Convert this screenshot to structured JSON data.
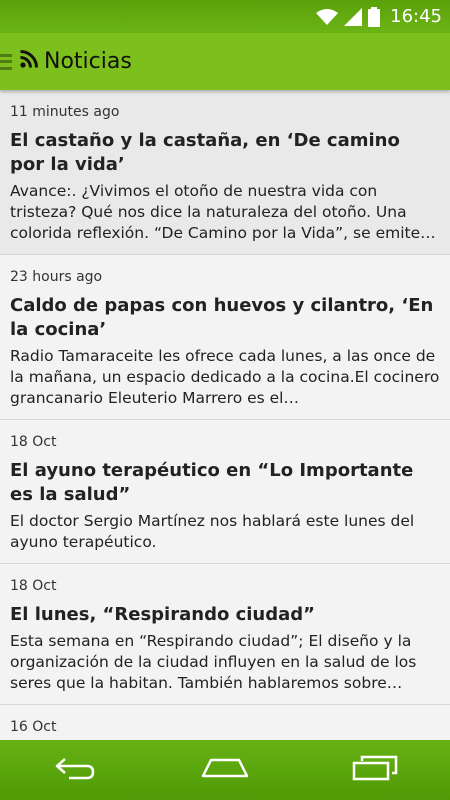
{
  "status_bar": {
    "time": "16:45",
    "icons": [
      "wifi-icon",
      "signal-icon",
      "battery-icon"
    ]
  },
  "action_bar": {
    "title": "Noticias",
    "icons": [
      "drawer-icon",
      "rss-icon"
    ]
  },
  "colors": {
    "status_bar": "#5aa00a",
    "action_bar": "#7dbf1c",
    "nav_bar": "#5aa60a",
    "list_background": "#f3f3f3"
  },
  "news": [
    {
      "date": "11 minutes ago",
      "title": "El castaño y la castaña, en ‘De camino por la vida’",
      "summary": "Avance:. ¿Vivimos el otoño de nuestra vida con tristeza? Qué nos dice la naturaleza del otoño. Una colorida reflexión. “De Camino por la Vida”, se emite…"
    },
    {
      "date": "23 hours ago",
      "title": "Caldo de papas con huevos y cilantro, ‘En la cocina’",
      "summary": "Radio Tamaraceite les ofrece cada lunes, a las once de la mañana, un espacio dedicado a la cocina.El cocinero grancanario Eleuterio Marrero es el…"
    },
    {
      "date": "18 Oct",
      "title": "El ayuno terapéutico en “Lo Importante es la salud”",
      "summary": "El doctor Sergio Martínez nos hablará este lunes del ayuno terapéutico."
    },
    {
      "date": "18 Oct",
      "title": "El lunes, “Respirando ciudad”",
      "summary": "Esta semana en “Respirando ciudad”; El diseño y la organización de la ciudad influyen en la salud de los seres que la habitan. También hablaremos sobre…"
    },
    {
      "date": "16 Oct",
      "title": "",
      "summary": ""
    }
  ],
  "nav_bar": {
    "icons": [
      "back-icon",
      "home-icon",
      "recents-icon"
    ]
  }
}
